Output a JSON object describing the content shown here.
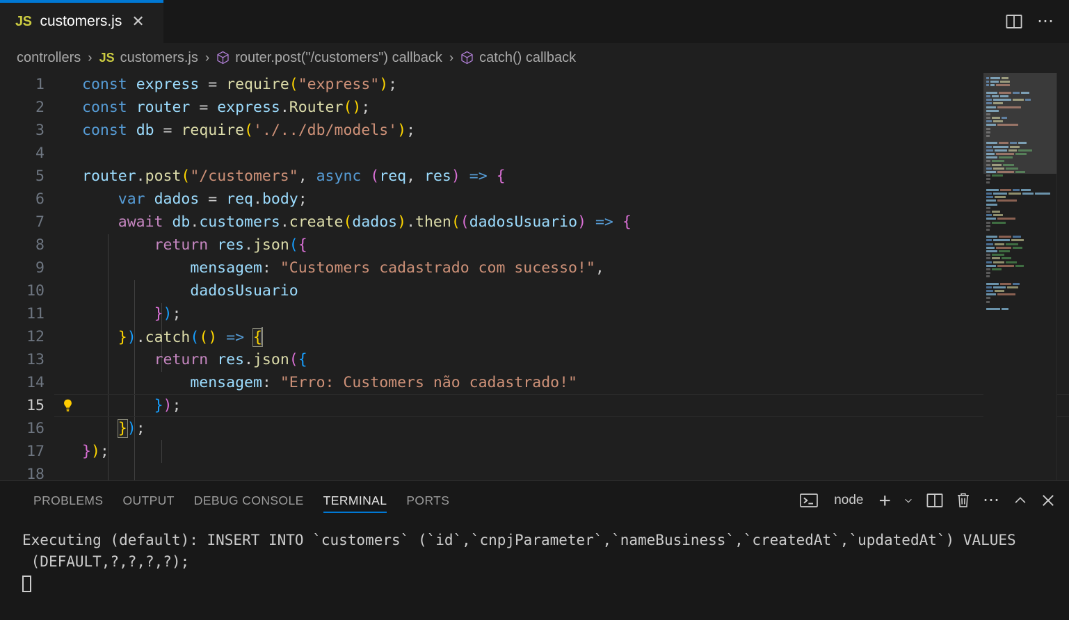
{
  "window": {
    "tab": {
      "icon": "js-file-icon",
      "label": "customers.js",
      "close": "✕"
    },
    "actions": {
      "split_editor": "split-editor-icon",
      "more": "⋯"
    }
  },
  "breadcrumb": {
    "items": [
      {
        "label": "controllers",
        "icon": "folder"
      },
      {
        "label": "customers.js",
        "icon": "js"
      },
      {
        "label": "router.post(\"/customers\") callback",
        "icon": "symbol-cube"
      },
      {
        "label": "catch() callback",
        "icon": "symbol-cube"
      }
    ],
    "separator": "›"
  },
  "editor": {
    "language": "javascript",
    "active_line": 15,
    "code_action_line": 15,
    "code_action_icon": "lightbulb-icon",
    "lines": [
      {
        "n": 1,
        "text": "const express = require(\"express\");"
      },
      {
        "n": 2,
        "text": "const router = express.Router();"
      },
      {
        "n": 3,
        "text": "const db = require('./../db/models');"
      },
      {
        "n": 4,
        "text": ""
      },
      {
        "n": 5,
        "text": "router.post(\"/customers\", async (req, res) => {"
      },
      {
        "n": 6,
        "text": "    var dados = req.body;"
      },
      {
        "n": 7,
        "text": "    await db.customers.create(dados).then((dadosUsuario) => {"
      },
      {
        "n": 8,
        "text": "        return res.json({"
      },
      {
        "n": 9,
        "text": "            mensagem: \"Customers cadastrado com sucesso!\","
      },
      {
        "n": 10,
        "text": "            dadosUsuario"
      },
      {
        "n": 11,
        "text": "        });"
      },
      {
        "n": 12,
        "text": "    }).catch(() => {"
      },
      {
        "n": 13,
        "text": "        return res.json({"
      },
      {
        "n": 14,
        "text": "            mensagem: \"Erro: Customers não cadastrado!\""
      },
      {
        "n": 15,
        "text": "        });"
      },
      {
        "n": 16,
        "text": "    });"
      },
      {
        "n": 17,
        "text": "});"
      },
      {
        "n": 18,
        "text": ""
      }
    ]
  },
  "panel": {
    "tabs": [
      {
        "label": "PROBLEMS",
        "active": false
      },
      {
        "label": "OUTPUT",
        "active": false
      },
      {
        "label": "DEBUG CONSOLE",
        "active": false
      },
      {
        "label": "TERMINAL",
        "active": true
      },
      {
        "label": "PORTS",
        "active": false
      }
    ],
    "toolbar": {
      "terminal_icon": "terminal-icon",
      "terminal_name": "node",
      "new_terminal": "+",
      "new_terminal_dropdown": "⌄",
      "split_terminal": "split-terminal-icon",
      "kill_terminal": "trash-icon",
      "views_and_more": "⋯",
      "maximize_panel": "chevron-up-icon",
      "close_panel": "✕"
    },
    "terminal": {
      "output_line_1": "Executing (default): INSERT INTO `customers` (`id`,`cnpjParameter`,`nameBusiness`,`createdAt`,`updatedAt`) VALUES",
      "output_line_2": " (DEFAULT,?,?,?,?);",
      "prompt_cursor": "block-cursor"
    }
  },
  "colors": {
    "editor_bg": "#1f1f1f",
    "tabbar_bg": "#181818",
    "panel_bg": "#181818",
    "accent": "#0078d4",
    "keyword": "#569cd6",
    "keyword_control": "#c586c0",
    "variable": "#9cdcfe",
    "function": "#dcdcaa",
    "string": "#ce9178",
    "bracket1": "#ffd700",
    "bracket2": "#da70d6",
    "bracket3": "#179fff",
    "linenumber": "#6e7681",
    "lightbulb": "#ffcc00"
  }
}
